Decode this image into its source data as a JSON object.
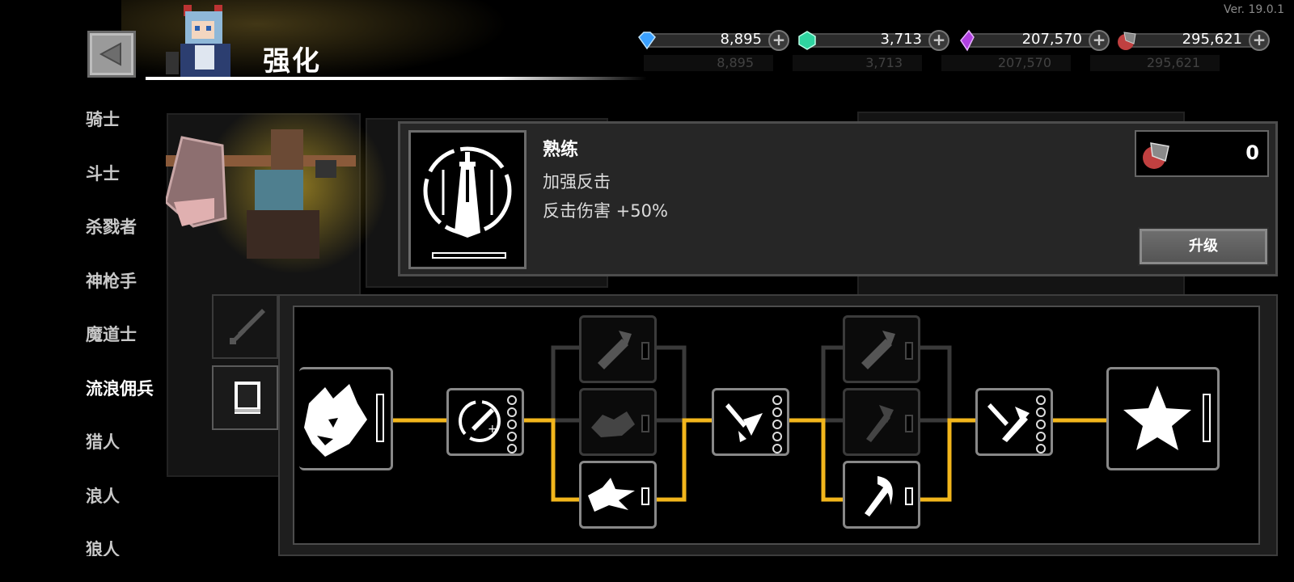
{
  "version": "Ver. 19.0.1",
  "header": {
    "title": "强化",
    "back_icon": "back-arrow-icon"
  },
  "currencies": [
    {
      "name": "blue-gem-icon",
      "value": "8,895",
      "color": "#3aa0ff"
    },
    {
      "name": "green-gem-icon",
      "value": "3,713",
      "color": "#2fd4a0"
    },
    {
      "name": "purple-crystal-icon",
      "value": "207,570",
      "color": "#b040e0"
    },
    {
      "name": "ore-icon",
      "value": "295,621",
      "color": "#e05050"
    }
  ],
  "currencies_ghost": [
    "8,895",
    "3,713",
    "207,570",
    "295,621"
  ],
  "sidebar": {
    "items": [
      {
        "label": "骑士"
      },
      {
        "label": "斗士"
      },
      {
        "label": "杀戮者"
      },
      {
        "label": "神枪手"
      },
      {
        "label": "魔道士"
      },
      {
        "label": "流浪佣兵",
        "active": true
      },
      {
        "label": "猎人"
      },
      {
        "label": "浪人"
      },
      {
        "label": "狼人"
      }
    ]
  },
  "detail": {
    "skill_name": "熟练",
    "subtitle": "加强反击",
    "effect": "反击伤害 +50%",
    "cost_value": "0",
    "upgrade_label": "升级"
  },
  "colors": {
    "path_active": "#f2b61c",
    "path_inactive": "#3a3a3a"
  }
}
